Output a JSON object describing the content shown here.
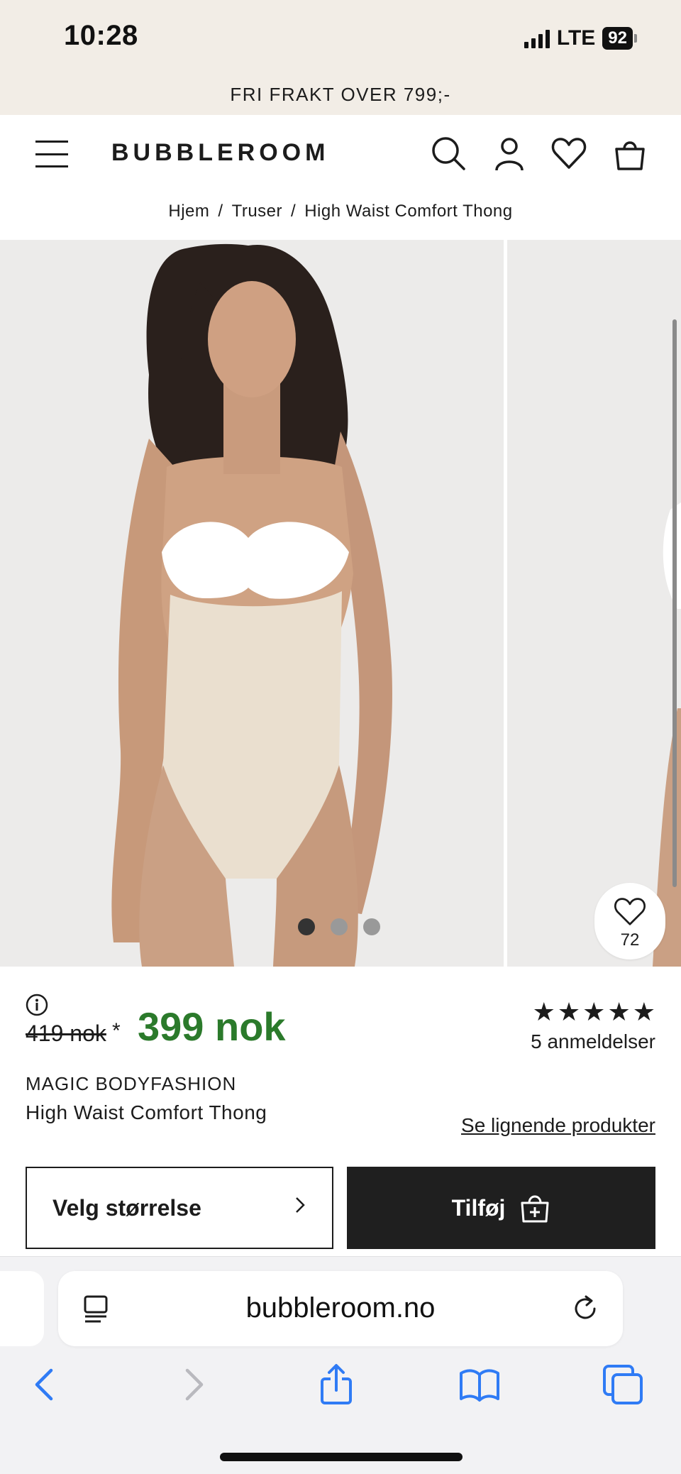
{
  "status_bar": {
    "time": "10:28",
    "network": "LTE",
    "battery": "92"
  },
  "promo": {
    "text": "FRI FRAKT OVER 799;-"
  },
  "header": {
    "logo": "BUBBLEROOM"
  },
  "breadcrumb": {
    "items": [
      "Hjem",
      "Truser",
      "High Waist Comfort Thong"
    ],
    "separator": "/"
  },
  "gallery": {
    "dots": 3,
    "active_dot": 0,
    "favorite_count": "72"
  },
  "product": {
    "old_price": "419 nok",
    "asterisk": "*",
    "price": "399 nok",
    "rating": 5,
    "reviews": "5 anmeldelser",
    "brand": "MAGIC BODYFASHION",
    "name": "High Waist Comfort Thong",
    "similar_link": "Se lignende produkter"
  },
  "actions": {
    "size_label": "Velg størrelse",
    "add_label": "Tilføj"
  },
  "browser": {
    "url": "bubbleroom.no"
  },
  "colors": {
    "price_green": "#2b7a2b",
    "beige": "#f2ede6",
    "ios_blue": "#2f7bf5"
  }
}
